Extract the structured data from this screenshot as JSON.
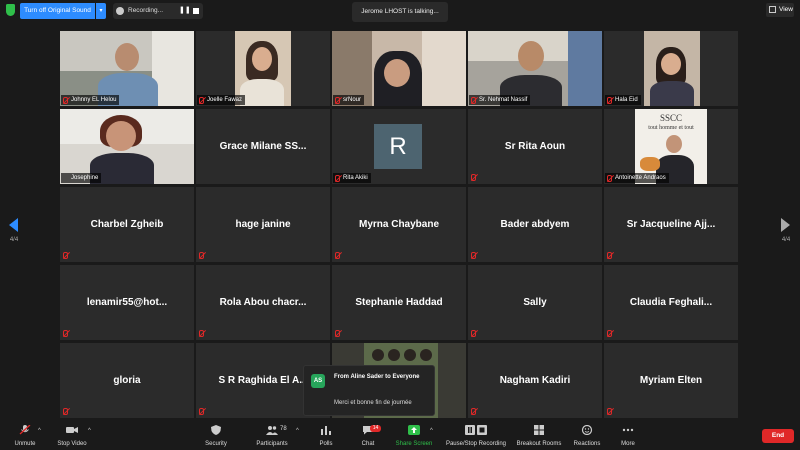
{
  "topbar": {
    "original_sound": "Turn off Original Sound",
    "recording": "Recording...",
    "talking": "Jerome LHOST is talking...",
    "view": "View"
  },
  "page": {
    "left": "4/4",
    "right": "4/4"
  },
  "participants": [
    {
      "label": "Johnny EL Helou",
      "type": "video"
    },
    {
      "label": "Joelle Fawaz",
      "type": "video"
    },
    {
      "label": "srNour",
      "type": "video"
    },
    {
      "label": "Sr. Nehmat Nassif",
      "type": "video"
    },
    {
      "label": "Hala Eid",
      "type": "video"
    },
    {
      "label": "Josephine",
      "type": "video"
    },
    {
      "name": "Grace Milane SS...",
      "type": "name"
    },
    {
      "label": "Rita Akiki",
      "avatar": "R",
      "type": "avatar"
    },
    {
      "name": "Sr Rita Aoun",
      "type": "name"
    },
    {
      "label": "Antoinette Andraos",
      "sign_text": "SSCC",
      "sign_sub": "tout homme et tout",
      "type": "video"
    },
    {
      "name": "Charbel Zgheib",
      "type": "name"
    },
    {
      "name": "hage janine",
      "type": "name"
    },
    {
      "name": "Myrna Chaybane",
      "type": "name"
    },
    {
      "name": "Bader abdyem",
      "type": "name"
    },
    {
      "name": "Sr Jacqueline Ajj...",
      "type": "name"
    },
    {
      "name": "lenamir55@hot...",
      "type": "name"
    },
    {
      "name": "Rola Abou chacr...",
      "type": "name"
    },
    {
      "name": "Stephanie Haddad",
      "type": "name"
    },
    {
      "name": "Sally",
      "type": "name"
    },
    {
      "name": "Claudia Feghali...",
      "type": "name"
    },
    {
      "name": "gloria",
      "type": "name"
    },
    {
      "name": "S R Raghida El A...",
      "type": "name"
    },
    {
      "name": "",
      "type": "video"
    },
    {
      "name": "Nagham Kadiri",
      "type": "name"
    },
    {
      "name": "Myriam Elten",
      "type": "name"
    }
  ],
  "chat": {
    "avatar": "AS",
    "from": "From Aline Sader to Everyone",
    "message": "Merci et bonne fin de journée"
  },
  "toolbar": {
    "unmute": "Unmute",
    "stop_video": "Stop Video",
    "security": "Security",
    "participants": "Participants",
    "participants_count": "78",
    "polls": "Polls",
    "chat": "Chat",
    "chat_badge": "14",
    "share_screen": "Share Screen",
    "pause_recording": "Pause/Stop Recording",
    "breakout_rooms": "Breakout Rooms",
    "reactions": "Reactions",
    "more": "More",
    "end": "End"
  },
  "colors": {
    "accent": "#2d8cff",
    "share": "#2fbf4a",
    "end": "#e02828",
    "tile": "#2b2b2b",
    "background": "#1a1a1a"
  }
}
